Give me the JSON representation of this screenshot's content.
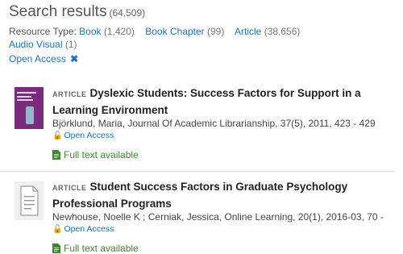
{
  "header": {
    "title": "Search results",
    "count": "(64,509)"
  },
  "facets": {
    "label": "Resource Type:",
    "items": [
      {
        "name": "Book",
        "count": "(1,420)"
      },
      {
        "name": "Book Chapter",
        "count": "(99)"
      },
      {
        "name": "Article",
        "count": "(38,656)"
      },
      {
        "name": "Audio Visual",
        "count": "(1)"
      }
    ]
  },
  "active_filter": {
    "label": "Open Access",
    "remove_icon": "close-icon"
  },
  "results": [
    {
      "type": "ARTICLE",
      "title_line1": "Dyslexic Students: Success Factors for Support in a",
      "title_line2": "Learning Environment",
      "citation": "Björklund, Maria, Journal Of Academic Librarianship, 37(5), 2011, 423 - 429",
      "open_access": "Open Access",
      "fulltext": "Full text available",
      "thumbnail": "journal-cover"
    },
    {
      "type": "ARTICLE",
      "title_line1": "Student Success Factors in Graduate Psychology",
      "title_line2": "Professional Programs",
      "citation": "Newhouse, Noelle K ; Cerniak, Jessica, Online Learning, 20(1), 2016-03, 70 -",
      "open_access": "Open Access",
      "fulltext": "Full text available",
      "thumbnail": "document-icon"
    }
  ],
  "colors": {
    "link": "#1a73c9",
    "fulltext": "#3b8a2e",
    "cover": "#7b2a7e"
  }
}
